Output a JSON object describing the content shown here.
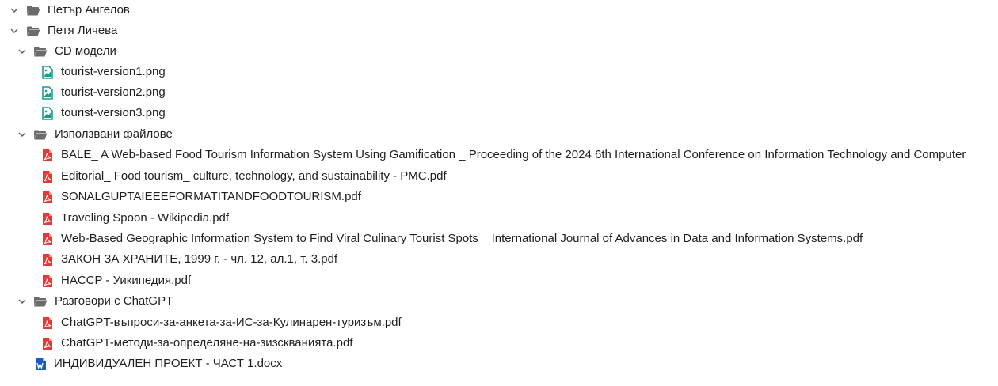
{
  "tree": {
    "folder_petar": {
      "label": "Петър Ангелов",
      "expanded": false,
      "icon": "folder-icon"
    },
    "folder_petya": {
      "label": "Петя Личева",
      "expanded": true,
      "icon": "folder-open-icon"
    },
    "folder_cd": {
      "label": "CD модели",
      "expanded": true,
      "icon": "folder-open-icon"
    },
    "cd_files": [
      {
        "label": "tourist-version1.png",
        "icon": "image-file-icon"
      },
      {
        "label": "tourist-version2.png",
        "icon": "image-file-icon"
      },
      {
        "label": "tourist-version3.png",
        "icon": "image-file-icon"
      }
    ],
    "folder_used": {
      "label": "Използвани файлове",
      "expanded": true,
      "icon": "folder-open-icon"
    },
    "used_files": [
      {
        "label": "BALE_ A Web-based Food Tourism Information System Using Gamification _ Proceeding of the 2024 6th International Conference on Information Technology and Computer",
        "icon": "pdf-file-icon"
      },
      {
        "label": "Editorial_ Food tourism_ culture, technology, and sustainability - PMC.pdf",
        "icon": "pdf-file-icon"
      },
      {
        "label": "SONALGUPTAIEEEFORMATITANDFOODTOURISM.pdf",
        "icon": "pdf-file-icon"
      },
      {
        "label": "Traveling Spoon - Wikipedia.pdf",
        "icon": "pdf-file-icon"
      },
      {
        "label": "Web-Based Geographic Information System to Find Viral Culinary Tourist Spots _ International Journal of Advances in Data and Information Systems.pdf",
        "icon": "pdf-file-icon"
      },
      {
        "label": "ЗАКОН ЗА ХРАНИТЕ, 1999 г. - чл. 12, ал.1, т. 3.pdf",
        "icon": "pdf-file-icon"
      },
      {
        "label": "HACCP - Уикипедия.pdf",
        "icon": "pdf-file-icon"
      }
    ],
    "folder_chat": {
      "label": "Разговори с ChatGPT",
      "expanded": true,
      "icon": "folder-open-icon"
    },
    "chat_files": [
      {
        "label": "ChatGPT-въпроси-за-анкета-за-ИС-за-Кулинарен-туризъм.pdf",
        "icon": "pdf-file-icon"
      },
      {
        "label": "ChatGPT-методи-за-определяне-на-зизскванията.pdf",
        "icon": "pdf-file-icon"
      }
    ],
    "docx_file": {
      "label": "ИНДИВИДУАЛЕН ПРОЕКТ - ЧАСТ 1.docx",
      "icon": "word-file-icon"
    }
  },
  "colors": {
    "text": "#1f1f1f",
    "chevron": "#5a5a5a",
    "folder": "#6b6b6b",
    "image_file": "#1a9c8c",
    "pdf_file": "#e53935",
    "word_file": "#1e5bb8"
  }
}
